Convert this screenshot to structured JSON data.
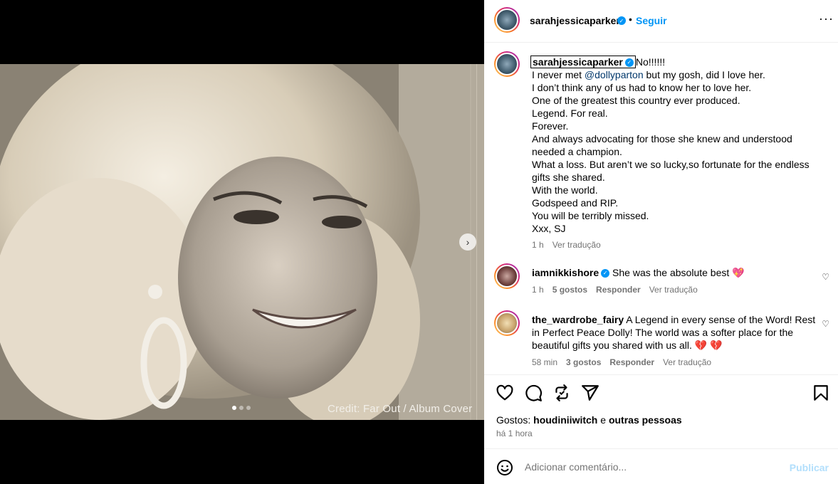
{
  "post": {
    "credit": "Credit: Far Out / Album Cover"
  },
  "header": {
    "username": "sarahjessicaparker",
    "separator": "•",
    "follow_label": "Seguir",
    "more_label": "···"
  },
  "caption": {
    "username": "sarahjessicaparker",
    "lines": [
      "No!!!!!!",
      "I never met ",
      "@dollyparton",
      " but my gosh, did I love her.",
      "I don’t think any of us had to know her to love her.",
      "One of the greatest this country ever produced.",
      "Legend. For real.",
      "Forever.",
      "And always advocating for those she knew and understood needed a champion.",
      "What a loss. But aren’t we so lucky,so fortunate for the endless gifts she shared.",
      "With the world.",
      "Godspeed and RIP.",
      "You will be terribly missed.",
      "Xxx, SJ"
    ],
    "time": "1 h",
    "translate": "Ver tradução"
  },
  "comments": [
    {
      "username": "iamnikkishore",
      "text": "She was the absolute best",
      "emoji": "💖",
      "time": "1 h",
      "likes": "5 gostos",
      "reply": "Responder",
      "translate": "Ver tradução"
    },
    {
      "username": "the_wardrobe_fairy",
      "text": "A Legend in every sense of the Word! Rest in Perfect Peace Dolly! The world was a softer place for the beautiful gifts you shared with us all.",
      "emoji": "💔 💔",
      "time": "58 min",
      "likes": "3 gostos",
      "reply": "Responder",
      "translate": "Ver tradução"
    }
  ],
  "likes_summary": {
    "prefix": "Gostos: ",
    "user": "houdiniiwitch",
    "connector": " e ",
    "others": "outras pessoas"
  },
  "posted_time": "há 1 hora",
  "add_comment": {
    "placeholder": "Adicionar comentário...",
    "publish_label": "Publicar"
  },
  "colors": {
    "accent": "#0095f6",
    "publish_disabled": "#b2dffc",
    "mention": "#00376b",
    "muted": "#737373"
  }
}
